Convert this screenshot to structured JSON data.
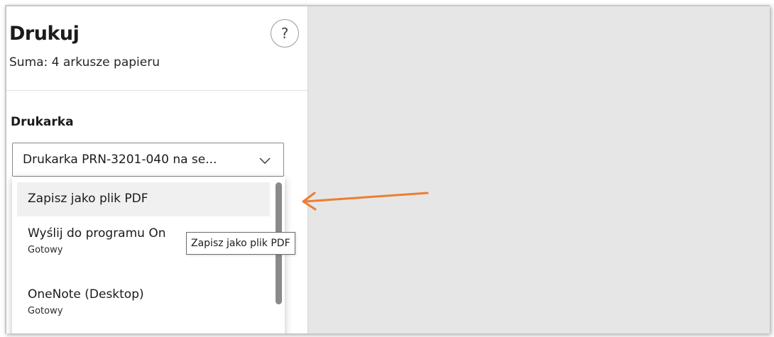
{
  "dialog": {
    "title": "Drukuj",
    "subtitle": "Suma: 4 arkusze papieru",
    "help_label": "?"
  },
  "printer": {
    "section_label": "Drukarka",
    "selected": "Drukarka PRN-3201-040 na se...",
    "options": [
      {
        "name": "Zapisz jako plik PDF",
        "status": ""
      },
      {
        "name": "Wyślij do programu On",
        "status": "Gotowy"
      },
      {
        "name": "OneNote (Desktop)",
        "status": "Gotowy"
      }
    ]
  },
  "tooltip": {
    "text": "Zapisz jako plik PDF"
  },
  "annotation": {
    "arrow_color": "#ed7d31"
  },
  "icons": {
    "help": "question-mark-icon",
    "dropdown": "chevron-down-icon"
  }
}
